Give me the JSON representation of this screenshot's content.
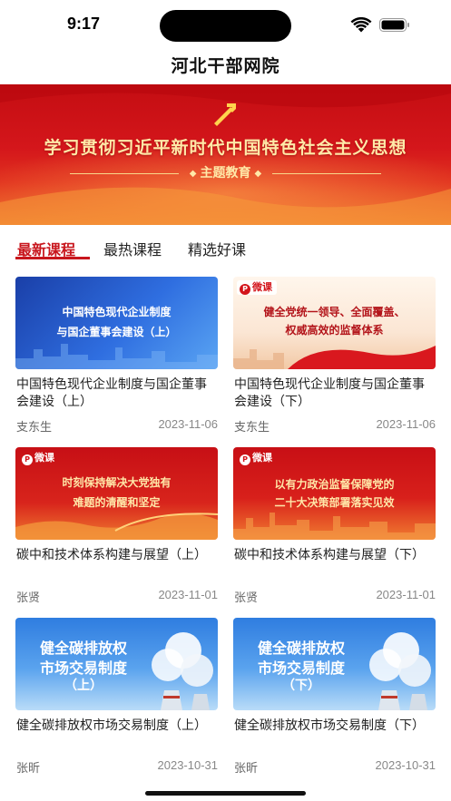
{
  "status_bar": {
    "time": "9:17"
  },
  "nav": {
    "title": "河北干部网院"
  },
  "banner": {
    "title": "学习贯彻习近平新时代中国特色社会主义思想",
    "subtitle": "主题教育"
  },
  "tabs": [
    {
      "label": "最新课程",
      "active": true
    },
    {
      "label": "最热课程",
      "active": false
    },
    {
      "label": "精选好课",
      "active": false
    }
  ],
  "badge_label": "微课",
  "courses": [
    {
      "thumb_text": [
        "中国特色现代企业制度",
        "与国企董事会建设（上）"
      ],
      "title": "中国特色现代企业制度与国企董事会建设（上）",
      "author": "支东生",
      "date": "2023-11-06"
    },
    {
      "thumb_text": [
        "健全党统一领导、全面覆盖、",
        "权威高效的监督体系"
      ],
      "title": "中国特色现代企业制度与国企董事会建设（下）",
      "author": "支东生",
      "date": "2023-11-06"
    },
    {
      "thumb_text": [
        "时刻保持解决大党独有",
        "难题的清醒和坚定"
      ],
      "title": "碳中和技术体系构建与展望（上）",
      "author": "张贤",
      "date": "2023-11-01"
    },
    {
      "thumb_text": [
        "以有力政治监督保障党的",
        "二十大决策部署落实见效"
      ],
      "title": "碳中和技术体系构建与展望（下）",
      "author": "张贤",
      "date": "2023-11-01"
    },
    {
      "thumb_text": [
        "健全碳排放权",
        "市场交易制度",
        "（上）"
      ],
      "title": "健全碳排放权市场交易制度（上）",
      "author": "张昕",
      "date": "2023-10-31"
    },
    {
      "thumb_text": [
        "健全碳排放权",
        "市场交易制度",
        "（下）"
      ],
      "title": "健全碳排放权市场交易制度（下）",
      "author": "张昕",
      "date": "2023-10-31"
    }
  ],
  "colors": {
    "accent": "#c8161d",
    "banner_red": "#d4161b",
    "thumb_blue": "#1e56c8"
  }
}
